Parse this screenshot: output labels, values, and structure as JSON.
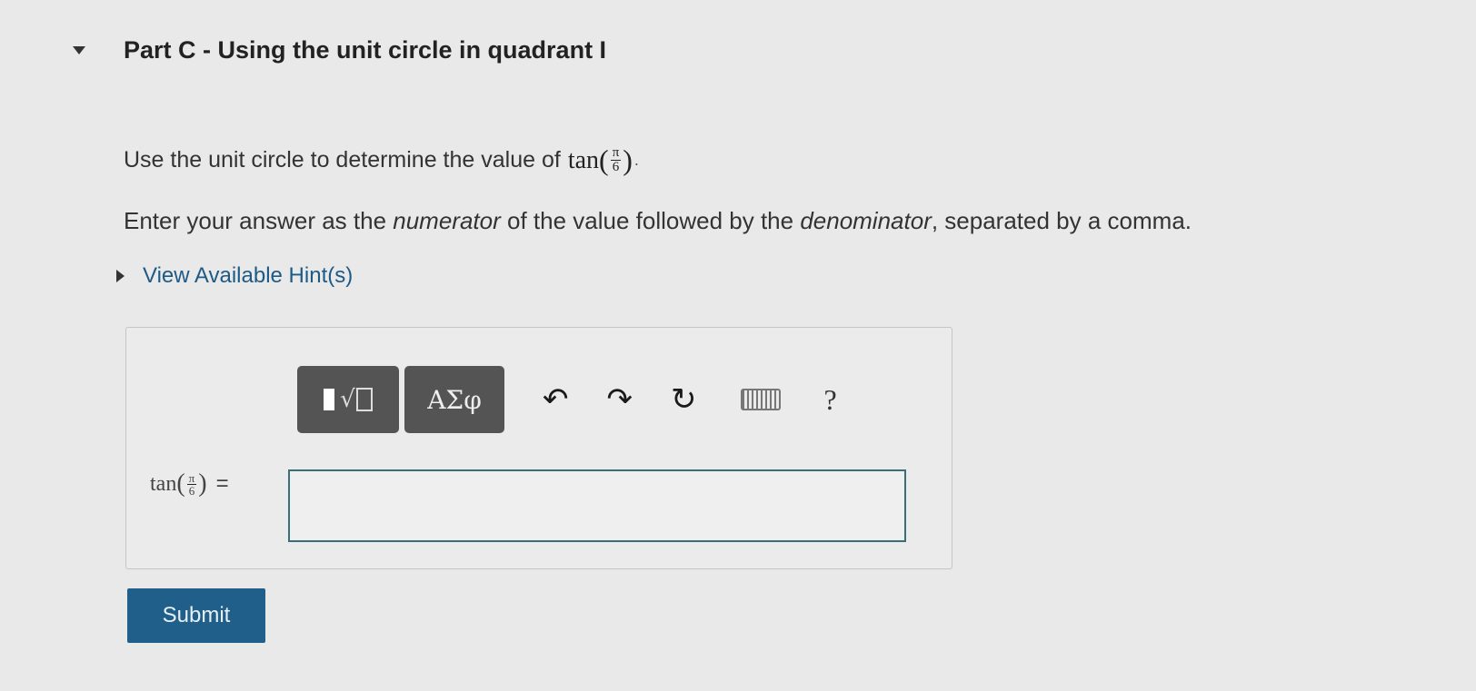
{
  "part": {
    "title": "Part C - Using the unit circle in quadrant I"
  },
  "question": {
    "prefix": "Use the unit circle to determine the value of",
    "func": "tan",
    "frac_num": "π",
    "frac_den": "6",
    "suffix": "."
  },
  "instruction": {
    "part1": "Enter your answer as the ",
    "emph1": "numerator",
    "part2": " of the value followed by the ",
    "emph2": "denominator",
    "part3": ", separated by a comma."
  },
  "hints": {
    "label": "View Available Hint(s)"
  },
  "toolbar": {
    "greek_label": "ΑΣφ",
    "undo_icon": "undo-icon",
    "redo_icon": "redo-icon",
    "reset_icon": "reset-icon",
    "keyboard_icon": "keyboard-icon",
    "help_label": "?"
  },
  "answer": {
    "label_func": "tan",
    "label_num": "π",
    "label_den": "6",
    "equals": "=",
    "value": ""
  },
  "submit": {
    "label": "Submit"
  },
  "colors": {
    "link": "#1e5a86",
    "submit_bg": "#1f5f8a",
    "toolbar_bg": "#545454",
    "input_border": "#3b6f77"
  }
}
